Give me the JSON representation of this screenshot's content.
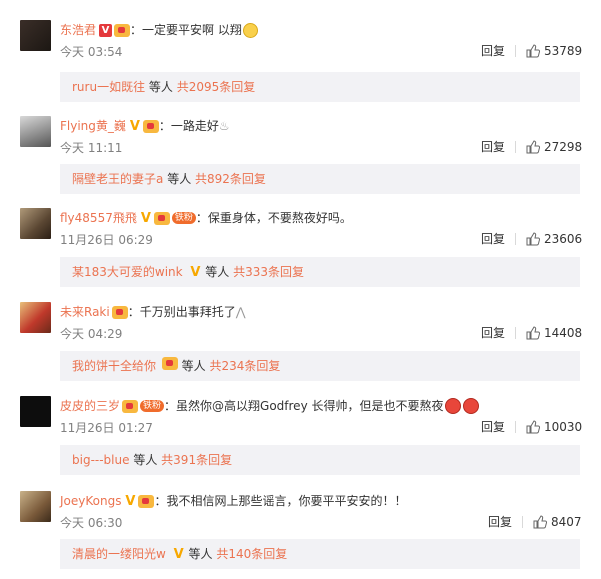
{
  "comments": [
    {
      "name": "东浩君",
      "text": "：一定要平安啊 以翔",
      "time": "今天 03:54",
      "reply_label": "回复",
      "likes": "53789",
      "sub": {
        "nick": "ruru一如既往",
        "mid": "等人",
        "count": "共2095条回复"
      }
    },
    {
      "name": "Flying黄_巍",
      "text": "：一路走好",
      "time": "今天 11:11",
      "reply_label": "回复",
      "likes": "27298",
      "sub": {
        "nick": "隔壁老王的妻子a",
        "mid": "等人",
        "count": "共892条回复"
      }
    },
    {
      "name": "fly48557飛飛",
      "fan_label": "铁粉",
      "text": "：保重身体，不要熬夜好吗。",
      "time": "11月26日 06:29",
      "reply_label": "回复",
      "likes": "23606",
      "sub": {
        "nick": "某183大可爱的wink",
        "mid": "等人",
        "count": "共333条回复"
      }
    },
    {
      "name": "未来Raki",
      "text": "：千万别出事拜托了",
      "time": "今天 04:29",
      "reply_label": "回复",
      "likes": "14408",
      "sub": {
        "nick": "我的饼干全给你",
        "mid": "等人",
        "count": "共234条回复"
      }
    },
    {
      "name": "皮皮的三岁",
      "fan_label": "铁粉",
      "text": "：虽然你@高以翔Godfrey 长得帅，但是也不要熬夜",
      "time": "11月26日 01:27",
      "reply_label": "回复",
      "likes": "10030",
      "sub": {
        "nick": "big---blue",
        "mid": "等人",
        "count": "共391条回复"
      }
    },
    {
      "name": "JoeyKongs",
      "text": "：我不相信网上那些谣言，你要平平安安的！！",
      "time": "今天 06:30",
      "reply_label": "回复",
      "likes": "8407",
      "sub": {
        "nick": "清晨的一缕阳光w",
        "mid": "等人",
        "count": "共140条回复"
      }
    }
  ],
  "colors": {
    "name": "#eb7350",
    "sub_bg": "#f2f2f5",
    "time": "#808080"
  },
  "icons": {
    "like": "thumbs-up-icon",
    "verified": "verified-v-icon",
    "member": "member-crown-icon"
  }
}
